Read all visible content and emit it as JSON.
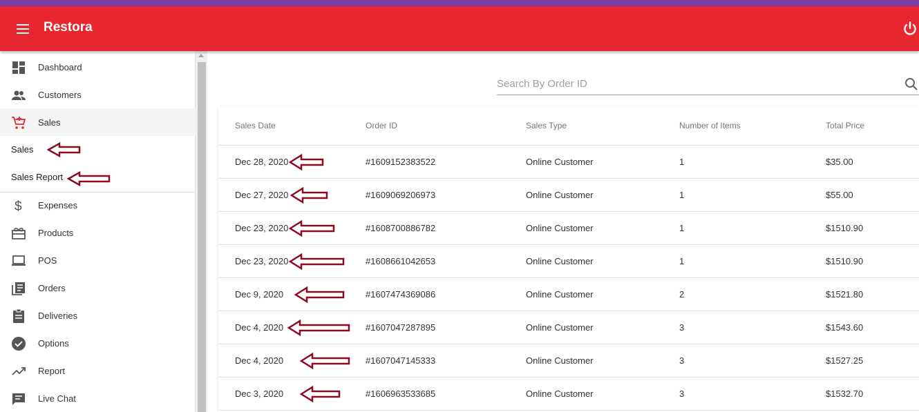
{
  "app": {
    "title": "Restora",
    "accent": "#e8262f",
    "top_strip": "#7a3fa8"
  },
  "sidebar": {
    "items": [
      {
        "label": "Dashboard",
        "icon": "dashboard-icon"
      },
      {
        "label": "Customers",
        "icon": "people-icon"
      },
      {
        "label": "Sales",
        "icon": "cart-icon",
        "active": true
      },
      {
        "label": "Expenses",
        "icon": "dollar-icon"
      },
      {
        "label": "Products",
        "icon": "gift-box-icon"
      },
      {
        "label": "POS",
        "icon": "laptop-icon"
      },
      {
        "label": "Orders",
        "icon": "list-icon"
      },
      {
        "label": "Deliveries",
        "icon": "clipboard-icon"
      },
      {
        "label": "Options",
        "icon": "check-circle-icon"
      },
      {
        "label": "Report",
        "icon": "trending-icon"
      },
      {
        "label": "Live Chat",
        "icon": "chat-icon"
      }
    ],
    "sales_submenu": [
      {
        "label": "Sales"
      },
      {
        "label": "Sales Report"
      }
    ]
  },
  "search": {
    "placeholder": "Search By Order ID"
  },
  "table": {
    "headers": [
      "Sales Date",
      "Order ID",
      "Sales Type",
      "Number of Items",
      "Total Price"
    ],
    "rows": [
      [
        "Dec 28, 2020",
        "#1609152383522",
        "Online Customer",
        "1",
        "$35.00"
      ],
      [
        "Dec 27, 2020",
        "#1609069206973",
        "Online Customer",
        "1",
        "$55.00"
      ],
      [
        "Dec 23, 2020",
        "#1608700886782",
        "Online Customer",
        "1",
        "$1510.90"
      ],
      [
        "Dec 23, 2020",
        "#1608661042653",
        "Online Customer",
        "1",
        "$1510.90"
      ],
      [
        "Dec 9, 2020",
        "#1607474369086",
        "Online Customer",
        "2",
        "$1521.80"
      ],
      [
        "Dec 4, 2020",
        "#1607047287895",
        "Online Customer",
        "3",
        "$1543.60"
      ],
      [
        "Dec 4, 2020",
        "#1607047145333",
        "Online Customer",
        "3",
        "$1527.25"
      ],
      [
        "Dec 3, 2020",
        "#1606963533685",
        "Online Customer",
        "3",
        "$1532.70"
      ]
    ]
  }
}
